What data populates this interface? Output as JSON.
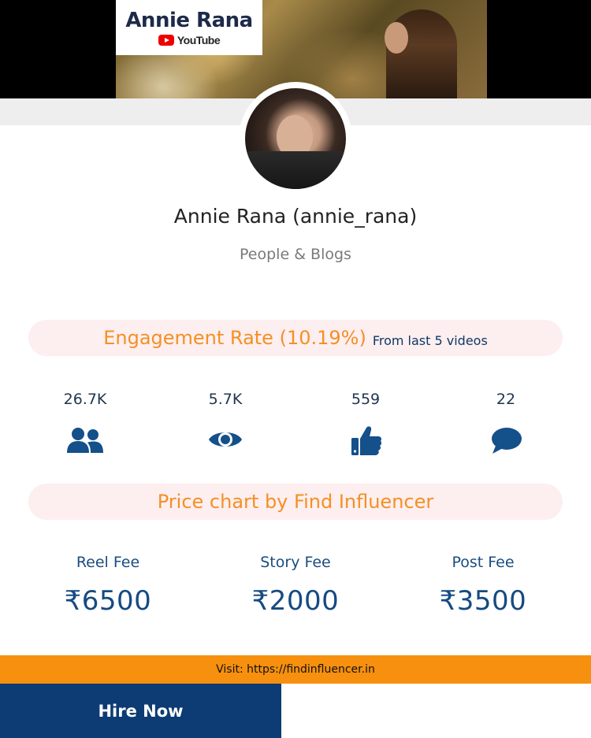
{
  "banner": {
    "logo_name": "Annie Rana",
    "logo_platform": "YouTube"
  },
  "profile": {
    "name": "Annie Rana (annie_rana)",
    "category": "People & Blogs"
  },
  "engagement": {
    "title": "Engagement Rate (10.19%)",
    "subtitle": "From last 5 videos"
  },
  "stats": [
    {
      "value": "26.7K",
      "icon": "users-icon"
    },
    {
      "value": "5.7K",
      "icon": "eye-icon"
    },
    {
      "value": "559",
      "icon": "thumbs-up-icon"
    },
    {
      "value": "22",
      "icon": "comment-icon"
    }
  ],
  "price_chart": {
    "title": "Price chart by Find Influencer"
  },
  "fees": [
    {
      "label": "Reel Fee",
      "value": "₹6500"
    },
    {
      "label": "Story Fee",
      "value": "₹2000"
    },
    {
      "label": "Post Fee",
      "value": "₹3500"
    }
  ],
  "footer": {
    "visit_text": "Visit: https://findinfluencer.in",
    "hire_label": "Hire Now"
  },
  "colors": {
    "accent_orange": "#f39123",
    "navy": "#0d3b73",
    "pill_bg": "#fdeef0",
    "icon_blue": "#14508a"
  }
}
